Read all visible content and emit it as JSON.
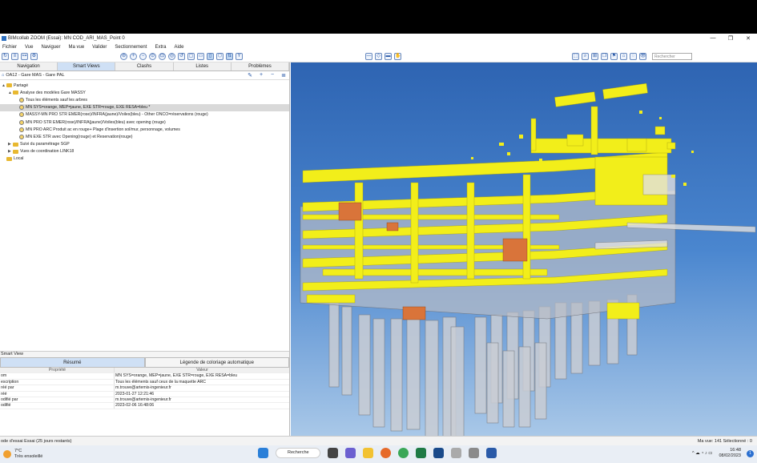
{
  "window": {
    "title": "BIMcollab ZOOM (Essai): MN COD_ARI_MAS_Point 0",
    "controls": [
      "—",
      "❐",
      "✕"
    ]
  },
  "menu": [
    "Fichier",
    "Vue",
    "Naviguer",
    "Ma vue",
    "Valider",
    "Sectionnement",
    "Extra",
    "Aide"
  ],
  "toolbar": {
    "search_placeholder": "Rechercher"
  },
  "tabs": [
    "Navigation",
    "Smart Views",
    "Clashs",
    "Listes",
    "Problèmes"
  ],
  "active_tab": "Smart Views",
  "crumb": "OA12 - Gare MAS - Gare PAL",
  "tree": [
    {
      "label": "Partagé",
      "level": 0,
      "kind": "folder",
      "tw": "▲"
    },
    {
      "label": "Analyse des modèles Gare MASSY",
      "level": 1,
      "kind": "folder",
      "tw": "▲"
    },
    {
      "label": "Tous les éléments sauf les arbres",
      "level": 2,
      "kind": "view",
      "tw": ""
    },
    {
      "label": "MN SYS=orange, MEP=jaune, EXE STR=rouge, EXE RESA=bleu *",
      "level": 2,
      "kind": "view",
      "tw": "",
      "selected": true
    },
    {
      "label": "MASSY-MN PRO STR EMER(rose)/INFRA(jaune)/Voiles(bleu) - Other ONCO=réservations (rouge)",
      "level": 2,
      "kind": "view",
      "tw": ""
    },
    {
      "label": "MN PRO STR EMER(rose)/INFRA(jaune)/Voiles(bleu) avec opening (rouge)",
      "level": 2,
      "kind": "view",
      "tw": ""
    },
    {
      "label": "MN PRO ARC Produit ac en rouge+ Plage d'insertion sol/mur, personnage, volumes",
      "level": 2,
      "kind": "view",
      "tw": ""
    },
    {
      "label": "MN EXE STR avec Opening(rouge) et Reservation(rouge)",
      "level": 2,
      "kind": "view",
      "tw": ""
    },
    {
      "label": "Suivi du paramétrage SGP",
      "level": 1,
      "kind": "folder",
      "tw": "▶"
    },
    {
      "label": "Vues de coordination LINK18",
      "level": 1,
      "kind": "folder",
      "tw": "▶"
    },
    {
      "label": "Local",
      "level": 0,
      "kind": "folder",
      "tw": ""
    }
  ],
  "smart_view": {
    "header": "Smart View",
    "tabs": [
      "Résumé",
      "Légende de coloriage automatique"
    ],
    "columns": [
      "Propriété",
      "Valeur"
    ],
    "rows": [
      [
        "om",
        "MN SYS=orange, MEP=jaune, EXE STR=rouge, EXE RESA=bleu"
      ],
      [
        "escription",
        "Tous les éléments sauf ceux de la maquette ARC"
      ],
      [
        "réé par",
        "m.trouve@artemis-ingenieur.fr"
      ],
      [
        "réé",
        "2023-01-27 12:21:46"
      ],
      [
        "odifié par",
        "m.trouve@artemis-ingenieur.fr"
      ],
      [
        "odifié",
        "2023-02-06 16:48:06"
      ]
    ]
  },
  "status": {
    "left": "ode d'essai   Essai (25 jours restants)",
    "right": "Ma vue: 141  Sélectionné : 0"
  },
  "taskbar": {
    "temp": "7°C",
    "weather": "Très ensoleillé",
    "search": "Recherche",
    "time": "16:48",
    "date": "08/02/2023",
    "notif": "1"
  },
  "colors": {
    "structure_yellow": "#f2ee1a",
    "sky_top": "#2e64b2",
    "sky_bottom": "#a9c8e8",
    "accent": "#cfe0f5"
  }
}
